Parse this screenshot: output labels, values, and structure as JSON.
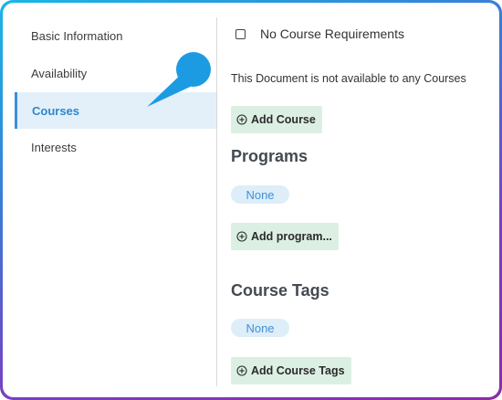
{
  "sidebar": {
    "items": [
      {
        "label": "Basic Information",
        "active": false
      },
      {
        "label": "Availability",
        "active": false
      },
      {
        "label": "Courses",
        "active": true
      },
      {
        "label": "Interests",
        "active": false
      }
    ]
  },
  "main": {
    "no_requirements_label": "No Course Requirements",
    "no_requirements_checked": false,
    "availability_text": "This Document is not available to any Courses",
    "add_course_label": "Add Course",
    "programs": {
      "title": "Programs",
      "value": "None",
      "add_label": "Add program..."
    },
    "course_tags": {
      "title": "Course Tags",
      "value": "None",
      "add_label": "Add Course Tags"
    }
  },
  "colors": {
    "accent": "#2e86cf",
    "callout": "#1c9be3",
    "button_bg": "#dcefe3",
    "pill_bg": "#ddeef9",
    "active_bg": "#e3f0f9"
  },
  "icons": {
    "add": "circle-plus-icon",
    "callout": "pointer-callout"
  }
}
